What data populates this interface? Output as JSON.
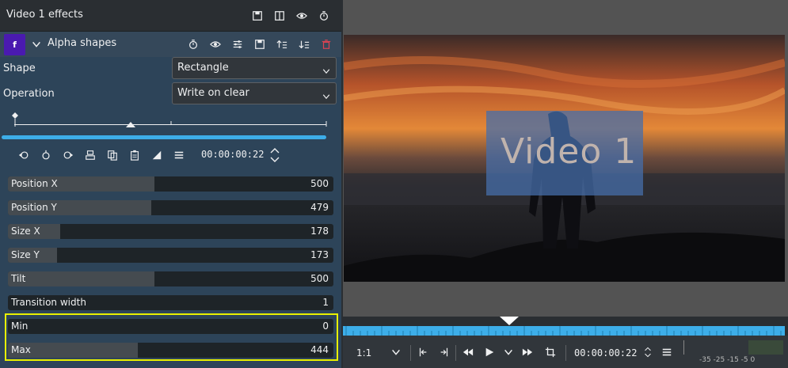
{
  "panel": {
    "title": "Video 1 effects"
  },
  "effect": {
    "badge": "f",
    "name": "Alpha shapes"
  },
  "params": {
    "shape_label": "Shape",
    "shape_value": "Rectangle",
    "operation_label": "Operation",
    "operation_value": "Write on clear"
  },
  "keyframes": {
    "timecode": "00:00:00:22"
  },
  "sliders": [
    {
      "label": "Position X",
      "value": "500",
      "fill": 0.45
    },
    {
      "label": "Position Y",
      "value": "479",
      "fill": 0.44
    },
    {
      "label": "Size X",
      "value": "178",
      "fill": 0.16
    },
    {
      "label": "Size Y",
      "value": "173",
      "fill": 0.15
    },
    {
      "label": "Tilt",
      "value": "500",
      "fill": 0.45
    },
    {
      "label": "Transition width",
      "value": "1",
      "fill": 0.0
    },
    {
      "label": "Min",
      "value": "0",
      "fill": 0.0
    },
    {
      "label": "Max",
      "value": "444",
      "fill": 0.4
    }
  ],
  "monitor": {
    "overlay_text": "Video 1",
    "zoom": "1:1",
    "timecode": "00:00:00:22",
    "audio_scale": "-35 -25    -15    -5  0"
  },
  "colors": {
    "accent": "#3daee9",
    "highlight": "#e8f000",
    "effect_badge": "#4a1ab0"
  }
}
